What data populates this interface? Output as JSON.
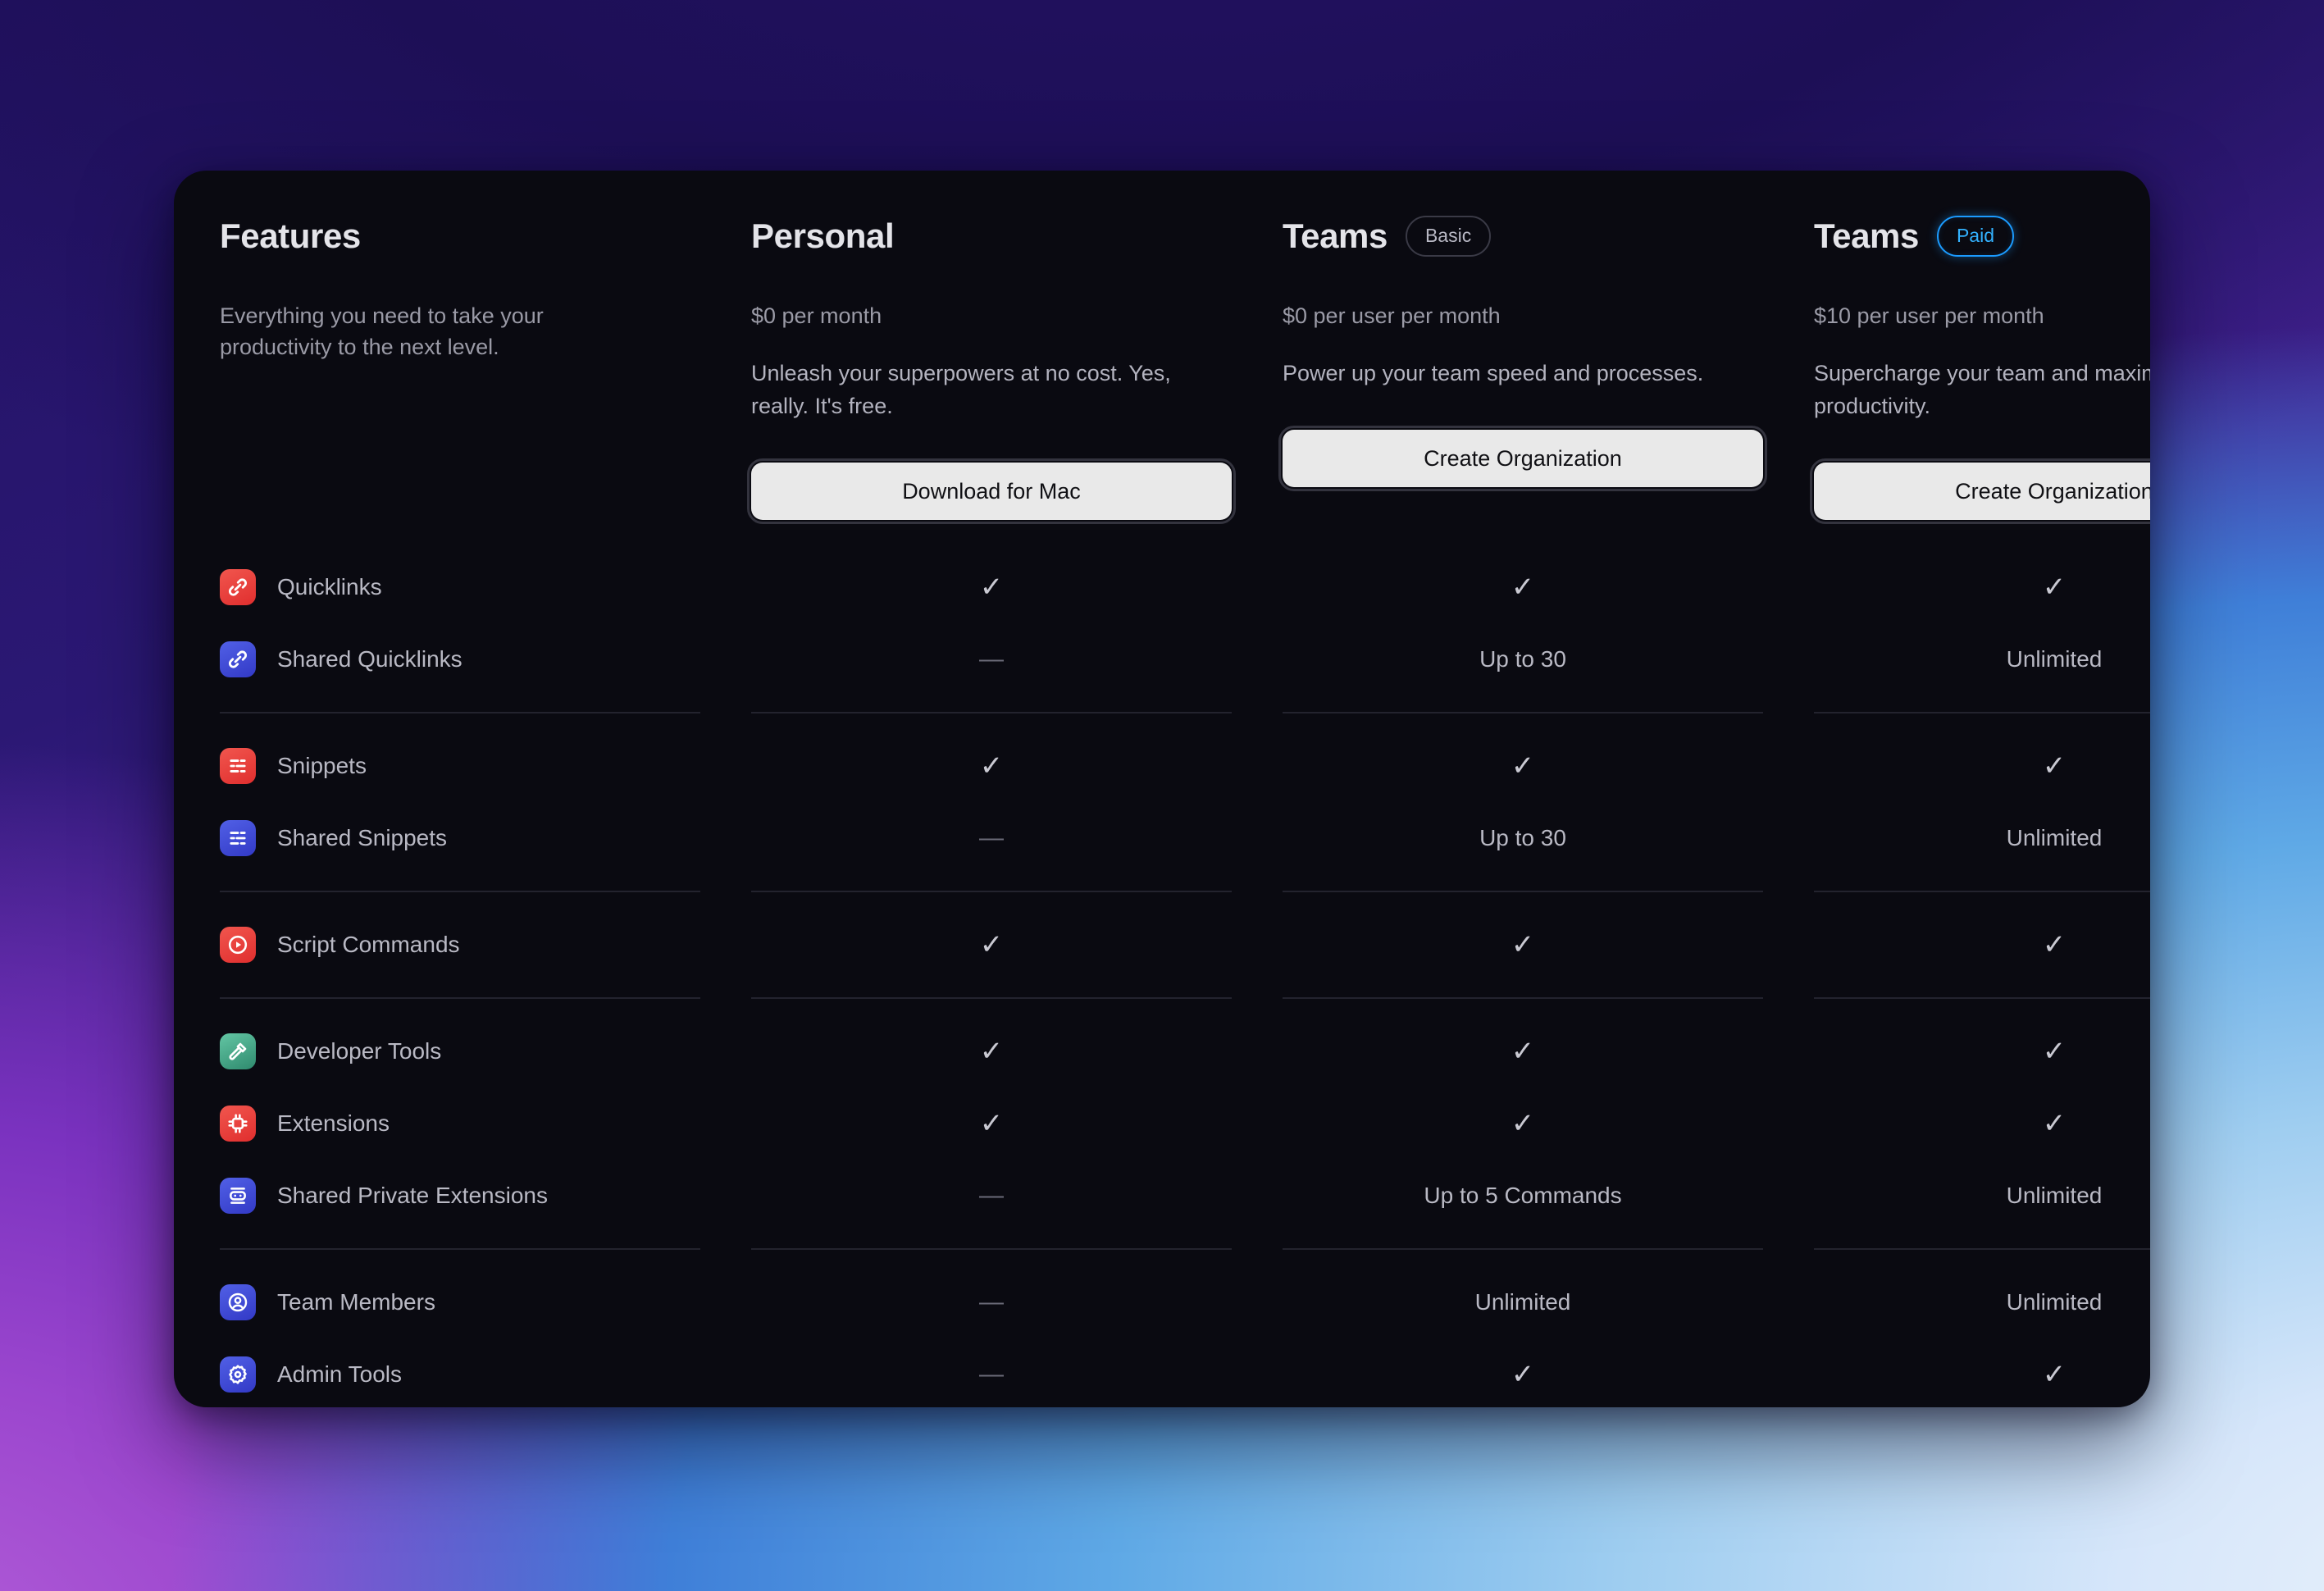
{
  "columns": [
    {
      "title": "Features",
      "badge": null,
      "subtitle": "Everything you need to take your productivity to the next level.",
      "price": null,
      "description": null,
      "cta": null
    },
    {
      "title": "Personal",
      "badge": null,
      "subtitle": null,
      "price": "$0 per month",
      "description": "Unleash your superpowers at no cost. Yes, really. It's free.",
      "cta": "Download for Mac"
    },
    {
      "title": "Teams",
      "badge": "Basic",
      "badge_style": "muted",
      "subtitle": null,
      "price": "$0 per user per month",
      "description": "Power up your team speed and processes.",
      "cta": "Create Organization"
    },
    {
      "title": "Teams",
      "badge": "Paid",
      "badge_style": "paid",
      "subtitle": null,
      "price": "$10 per user per month",
      "description": "Supercharge your team and maximize productivity.",
      "cta": "Create Organization"
    }
  ],
  "colors": {
    "accent_paid": "#1b9bff",
    "icon_red": "#ec3b3b",
    "icon_blue": "#4250d8",
    "icon_green": "#3fa383",
    "card_bg": "#0a0a11",
    "cta_bg": "#e9e9e9",
    "divider": "#23232e"
  },
  "symbols": {
    "check": "✓",
    "dash": "—"
  },
  "groups": [
    {
      "rows": [
        {
          "icon": "link-icon",
          "icon_color": "red",
          "label": "Quicklinks",
          "personal": "✓",
          "teams_basic": "✓",
          "teams_paid": "✓",
          "personal_type": "check",
          "teams_basic_type": "check",
          "teams_paid_type": "check"
        },
        {
          "icon": "link-icon",
          "icon_color": "blue",
          "label": "Shared Quicklinks",
          "personal": "—",
          "teams_basic": "Up to 30",
          "teams_paid": "Unlimited",
          "personal_type": "dash",
          "teams_basic_type": "text",
          "teams_paid_type": "text"
        }
      ]
    },
    {
      "rows": [
        {
          "icon": "snippet-icon",
          "icon_color": "red",
          "label": "Snippets",
          "personal": "✓",
          "teams_basic": "✓",
          "teams_paid": "✓",
          "personal_type": "check",
          "teams_basic_type": "check",
          "teams_paid_type": "check"
        },
        {
          "icon": "snippet-icon",
          "icon_color": "blue",
          "label": "Shared Snippets",
          "personal": "—",
          "teams_basic": "Up to 30",
          "teams_paid": "Unlimited",
          "personal_type": "dash",
          "teams_basic_type": "text",
          "teams_paid_type": "text"
        }
      ]
    },
    {
      "rows": [
        {
          "icon": "play-circle-icon",
          "icon_color": "red",
          "label": "Script Commands",
          "personal": "✓",
          "teams_basic": "✓",
          "teams_paid": "✓",
          "personal_type": "check",
          "teams_basic_type": "check",
          "teams_paid_type": "check"
        }
      ]
    },
    {
      "rows": [
        {
          "icon": "hammer-icon",
          "icon_color": "green",
          "label": "Developer Tools",
          "personal": "✓",
          "teams_basic": "✓",
          "teams_paid": "✓",
          "personal_type": "check",
          "teams_basic_type": "check",
          "teams_paid_type": "check"
        },
        {
          "icon": "chip-icon",
          "icon_color": "red",
          "label": "Extensions",
          "personal": "✓",
          "teams_basic": "✓",
          "teams_paid": "✓",
          "personal_type": "check",
          "teams_basic_type": "check",
          "teams_paid_type": "check"
        },
        {
          "icon": "robot-icon",
          "icon_color": "blue",
          "label": "Shared Private Extensions",
          "personal": "—",
          "teams_basic": "Up to 5 Commands",
          "teams_paid": "Unlimited",
          "personal_type": "dash",
          "teams_basic_type": "text",
          "teams_paid_type": "text"
        }
      ]
    },
    {
      "rows": [
        {
          "icon": "person-circle-icon",
          "icon_color": "blue",
          "label": "Team Members",
          "personal": "—",
          "teams_basic": "Unlimited",
          "teams_paid": "Unlimited",
          "personal_type": "dash",
          "teams_basic_type": "text",
          "teams_paid_type": "text"
        },
        {
          "icon": "gear-icon",
          "icon_color": "blue",
          "label": "Admin Tools",
          "personal": "—",
          "teams_basic": "✓",
          "teams_paid": "✓",
          "personal_type": "dash",
          "teams_basic_type": "check",
          "teams_paid_type": "check"
        }
      ]
    }
  ]
}
